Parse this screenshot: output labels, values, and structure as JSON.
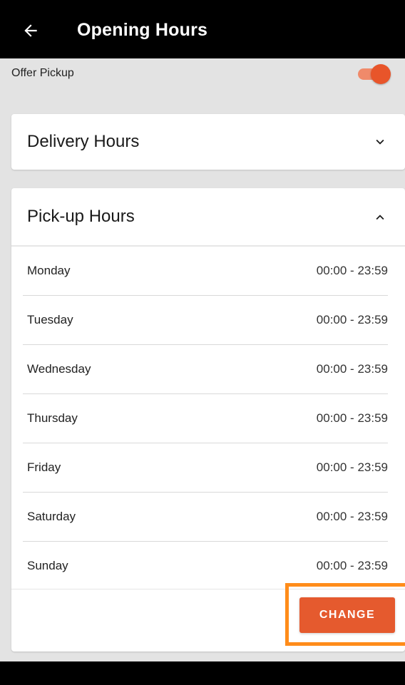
{
  "appbar": {
    "title": "Opening Hours",
    "back_icon": "arrow-left-icon"
  },
  "pickup_toggle": {
    "label": "Offer Pickup",
    "enabled": true,
    "accent_color": "#e8552a"
  },
  "delivery_section": {
    "title": "Delivery Hours",
    "expanded": false,
    "icon": "chevron-down-icon"
  },
  "pickup_section": {
    "title": "Pick-up Hours",
    "expanded": true,
    "icon": "chevron-up-icon",
    "hours": [
      {
        "day": "Monday",
        "time": "00:00 - 23:59"
      },
      {
        "day": "Tuesday",
        "time": "00:00 - 23:59"
      },
      {
        "day": "Wednesday",
        "time": "00:00 - 23:59"
      },
      {
        "day": "Thursday",
        "time": "00:00 - 23:59"
      },
      {
        "day": "Friday",
        "time": "00:00 - 23:59"
      },
      {
        "day": "Saturday",
        "time": "00:00 - 23:59"
      },
      {
        "day": "Sunday",
        "time": "00:00 - 23:59"
      }
    ],
    "change_label": "CHANGE",
    "button_color": "#e55a2e",
    "highlight_color": "#ff8c1a"
  }
}
